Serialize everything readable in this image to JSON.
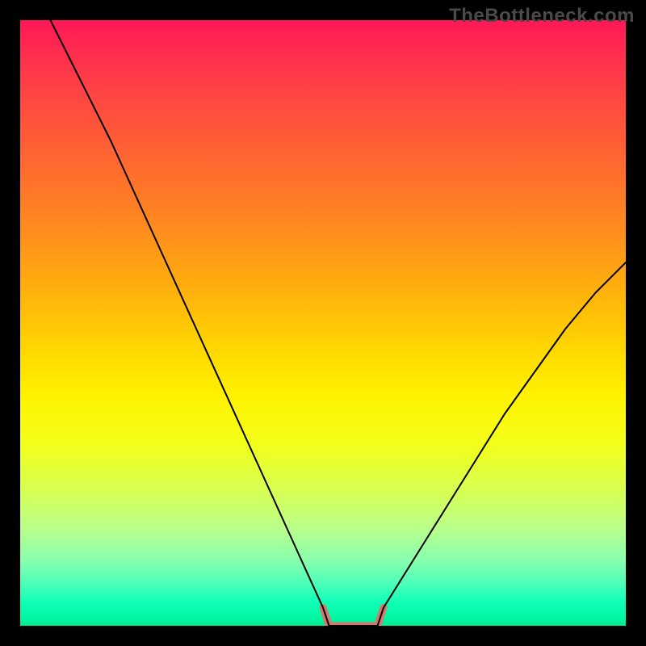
{
  "watermark": "TheBottleneck.com",
  "chart_data": {
    "type": "line",
    "title": "",
    "xlabel": "",
    "ylabel": "",
    "xlim": [
      0,
      100
    ],
    "ylim": [
      0,
      100
    ],
    "grid": false,
    "legend": false,
    "annotations": [],
    "series": [
      {
        "name": "main-curve",
        "color": "#000000",
        "width": 2,
        "x": [
          5,
          10,
          15,
          20,
          25,
          30,
          35,
          40,
          45,
          50,
          51,
          55,
          59,
          60,
          65,
          70,
          75,
          80,
          85,
          90,
          95,
          100
        ],
        "y": [
          100,
          90,
          80,
          69,
          58,
          47,
          36,
          25,
          14,
          3,
          0,
          0,
          0,
          3,
          11,
          19,
          27,
          35,
          42,
          49,
          55,
          60
        ]
      },
      {
        "name": "valley-highlight",
        "color": "#d8776c",
        "width": 9,
        "x": [
          50,
          51,
          55,
          59,
          60
        ],
        "y": [
          3,
          0,
          0,
          0,
          3
        ]
      }
    ],
    "gradient_axis": "y",
    "gradient_stops": [
      {
        "pos": 0.0,
        "color": "#ff1757"
      },
      {
        "pos": 0.14,
        "color": "#ff4a41"
      },
      {
        "pos": 0.34,
        "color": "#ff8a1e"
      },
      {
        "pos": 0.54,
        "color": "#ffd600"
      },
      {
        "pos": 0.7,
        "color": "#f3ff1a"
      },
      {
        "pos": 0.84,
        "color": "#b9ff8c"
      },
      {
        "pos": 0.93,
        "color": "#4dffb9"
      },
      {
        "pos": 1.0,
        "color": "#00e68c"
      }
    ]
  }
}
